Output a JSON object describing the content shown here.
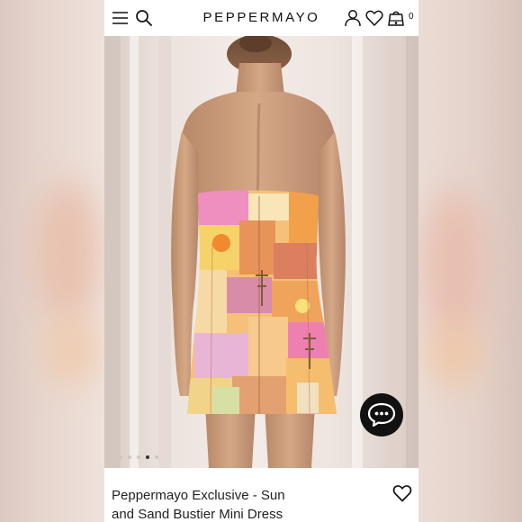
{
  "header": {
    "menu_icon": "hamburger-menu-icon",
    "search_icon": "search-icon",
    "brand": "PEPPERMAYO",
    "account_icon": "user-icon",
    "wishlist_icon": "heart-icon",
    "cart_icon": "shopping-bag-icon",
    "cart_count": "0"
  },
  "gallery": {
    "image_count": 6,
    "active_index": 4
  },
  "chat": {
    "icon": "chat-bubble-icon"
  },
  "product": {
    "title_line1": "Peppermayo Exclusive - Sun",
    "title_line2": "and Sand Bustier Mini Dress",
    "wishlist_icon": "heart-outline-icon"
  },
  "colors": {
    "accent": "#111111",
    "dress_pink": "#e98fc0",
    "dress_orange": "#f0a046",
    "dress_yellow": "#f5d36a"
  }
}
